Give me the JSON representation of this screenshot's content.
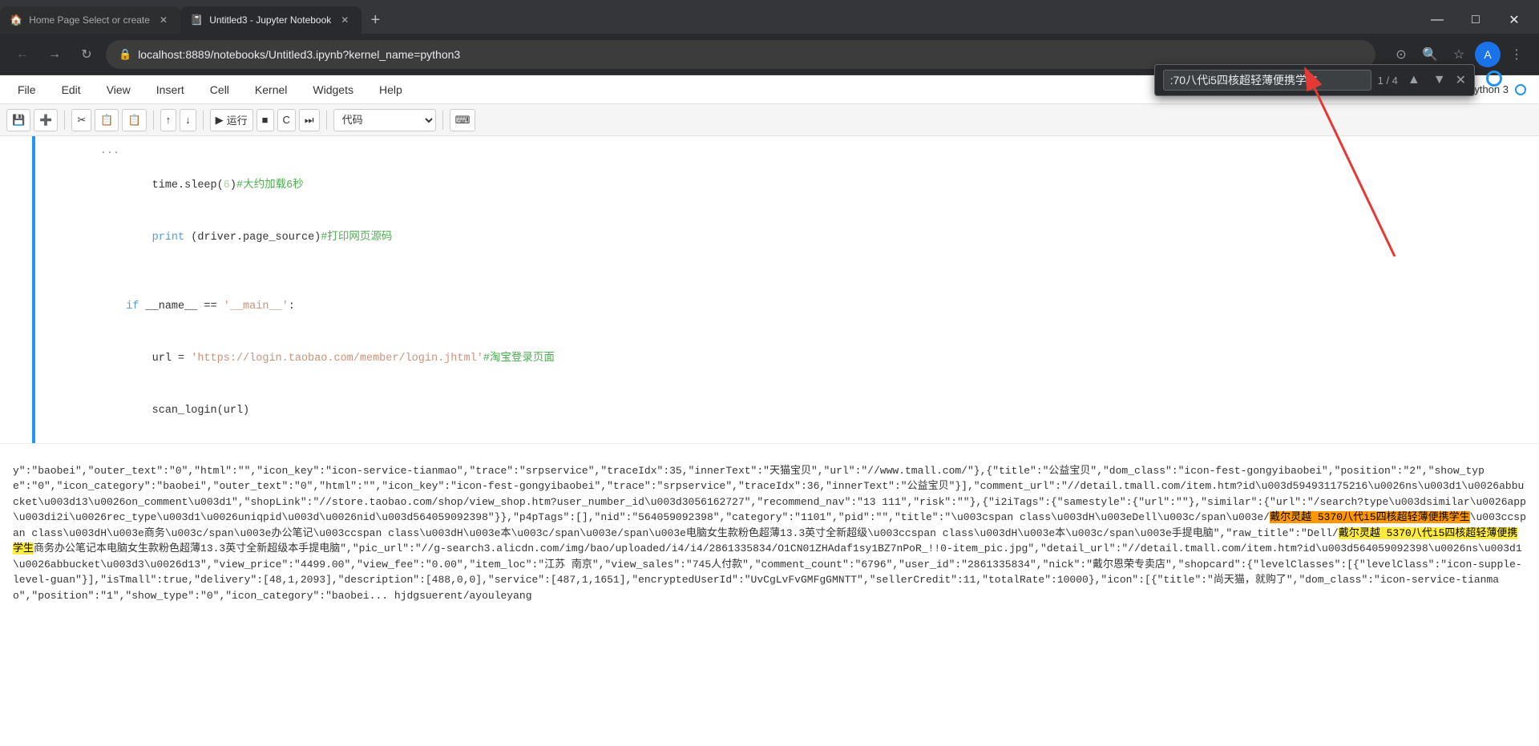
{
  "browser": {
    "tabs": [
      {
        "id": "tab1",
        "title": "Home Page Select or create",
        "favicon": "🏠",
        "active": false
      },
      {
        "id": "tab2",
        "title": "Untitled3 - Jupyter Notebook",
        "favicon": "📓",
        "active": true
      }
    ],
    "new_tab_label": "+",
    "url": "localhost:8889/notebooks/Untitled3.ipynb?kernel_name=python3",
    "window_controls": {
      "minimize": "—",
      "maximize": "□",
      "close": "✕"
    }
  },
  "jupyter": {
    "menu_items": [
      "File",
      "Edit",
      "View",
      "Insert",
      "Cell",
      "Kernel",
      "Widgets",
      "Help"
    ],
    "toolbar": {
      "buttons": [
        "💾",
        "➕",
        "✂",
        "📋",
        "📋",
        "↑",
        "↓",
        "▶ 运行",
        "■",
        "C",
        "⏭",
        "代码"
      ],
      "run_label": "运行",
      "code_label": "代码"
    }
  },
  "search": {
    "query": ":70八代i5四核超轻薄便携学生",
    "count": "1 / 4",
    "prev": "▲",
    "next": "▼",
    "close": "✕"
  },
  "code": {
    "line1": "    time.sleep(6)#大约加载6秒",
    "line2": "    print (driver.page_source)#打印网页源码",
    "line3": "",
    "line4": "    if __name__ == '__main__':",
    "line5": "        url = 'https://login.taobao.com/member/login.jhtml'#淘宝登录页面",
    "line6": "        scan_login(url)",
    "output": "y\":\"baobei\",\"outer_text\":\"0\",\"html\":\"\",\"icon_key\":\"icon-service-tianmao\",\"trace\":\"srpservice\",\"traceIdx\":35,\"innerText\":\"天猫宝贝\",\"url\":\"//www.tmall.com/\"},{\"title\":\"公益宝贝\",\"dom_class\":\"icon-fest-gongyibaobei\",\"position\":\"2\",\"show_type\":\"0\",\"icon_category\":\"baobei\",\"outer_text\":\"0\",\"html\":\"\",\"icon_key\":\"icon-fest-gongyibaobei\",\"trace\":\"srpservice\",\"traceIdx\":36,\"innerText\":\"公益宝贝\"}],\"comment_url\":\"//detail.tmall.com/item.htm?id\\u003d594931175216\\u0026ns\\u003d1\\u0026abbucket\\u003d13\\u0026on_comment\\u003d1\",\"shopLink\":\"//store.taobao.com/shop/view_shop.htm?user_number_id\\u003d3056162727\",\"recommend_nav\":\"13 111\",\"risk\":\"\"},{\"i2iTags\":{\"samestyle\":{\"url\":\"\"},\"similar\":{\"url\":\"/search?type\\u003dsimilar\\u0026app\\u003di2i\\u0026rec_type\\u003d1\\u0026uniqpid\\u003d\\u0026nid\\u003d564059092398\"}},\"p4pTags\":[],\"nid\":\"564059092398\",\"category\":\"1101\",\"pid\":\"\",\"title\":\"\\u003cspan class\\u003dH\\u003eDell\\u003c/span\\u003e/戴尔灵越 5370八代i5四核超轻薄便携学生\\u003ccspan class\\u003dH\\u003e商务\\u003c/span\\u003e办公笔记\\u003ccspan class\\u003dH\\u003e本\\u003c/span\\u003e/span\\u003e电脑女生款粉色超薄13.3英寸全新超级\\u003ccspan class\\u003dH\\u003e本\\u003c/span\\u003e手提电脑\",\"raw_title\":\"Dell/戴尔灵越 5370八代i5四核超轻薄便携学生商务办公笔记本电脑女生款粉色超薄13.3英寸全新超级本手提电脑\",\"pic_url\":\"//g-search3.alicdn.com/img/bao/uploaded/i4/i4/2861335834/O1CN01ZHAdaf1sy1BZ7nPoR_!!0-item_pic.jpg\",\"detail_url\":\"//detail.tmall.com/item.htm?id\\u003d564059092398\\u0026ns\\u003d1\\u0026abbucket\\u003d3\\u0026d13\",\"view_price\":\"4499.00\",\"view_fee\":\"0.00\",\"item_loc\":\"江苏 南京\",\"view_sales\":\"745人付款\",\"comment_count\":\"6796\",\"user_id\":\"2861335834\",\"nick\":\"戴尔恩荣专卖店\",\"shopcard\":{\"levelClasses\":[{\"levelClass\":\"icon-supple-level-guan\"}],\"isTmall\":true,\"delivery\":[48,1,2093],\"description\":[488,0,0],\"service\":[487,1,1651],\"encryptedUserId\":\"UvCgLvFvGMFgGMNTT\",\"sellerCredit\":11,\"totalRate\":10000},\"icon\":[{\"title\":\"尚天猫，就购了\",\"dom_class\":\"icon-service-tianmao\",\"position\":\"1\",\"show_type\":\"0\",\"icon_category\":\"baobei... hjdgsuerent/ayouleyang"
  }
}
